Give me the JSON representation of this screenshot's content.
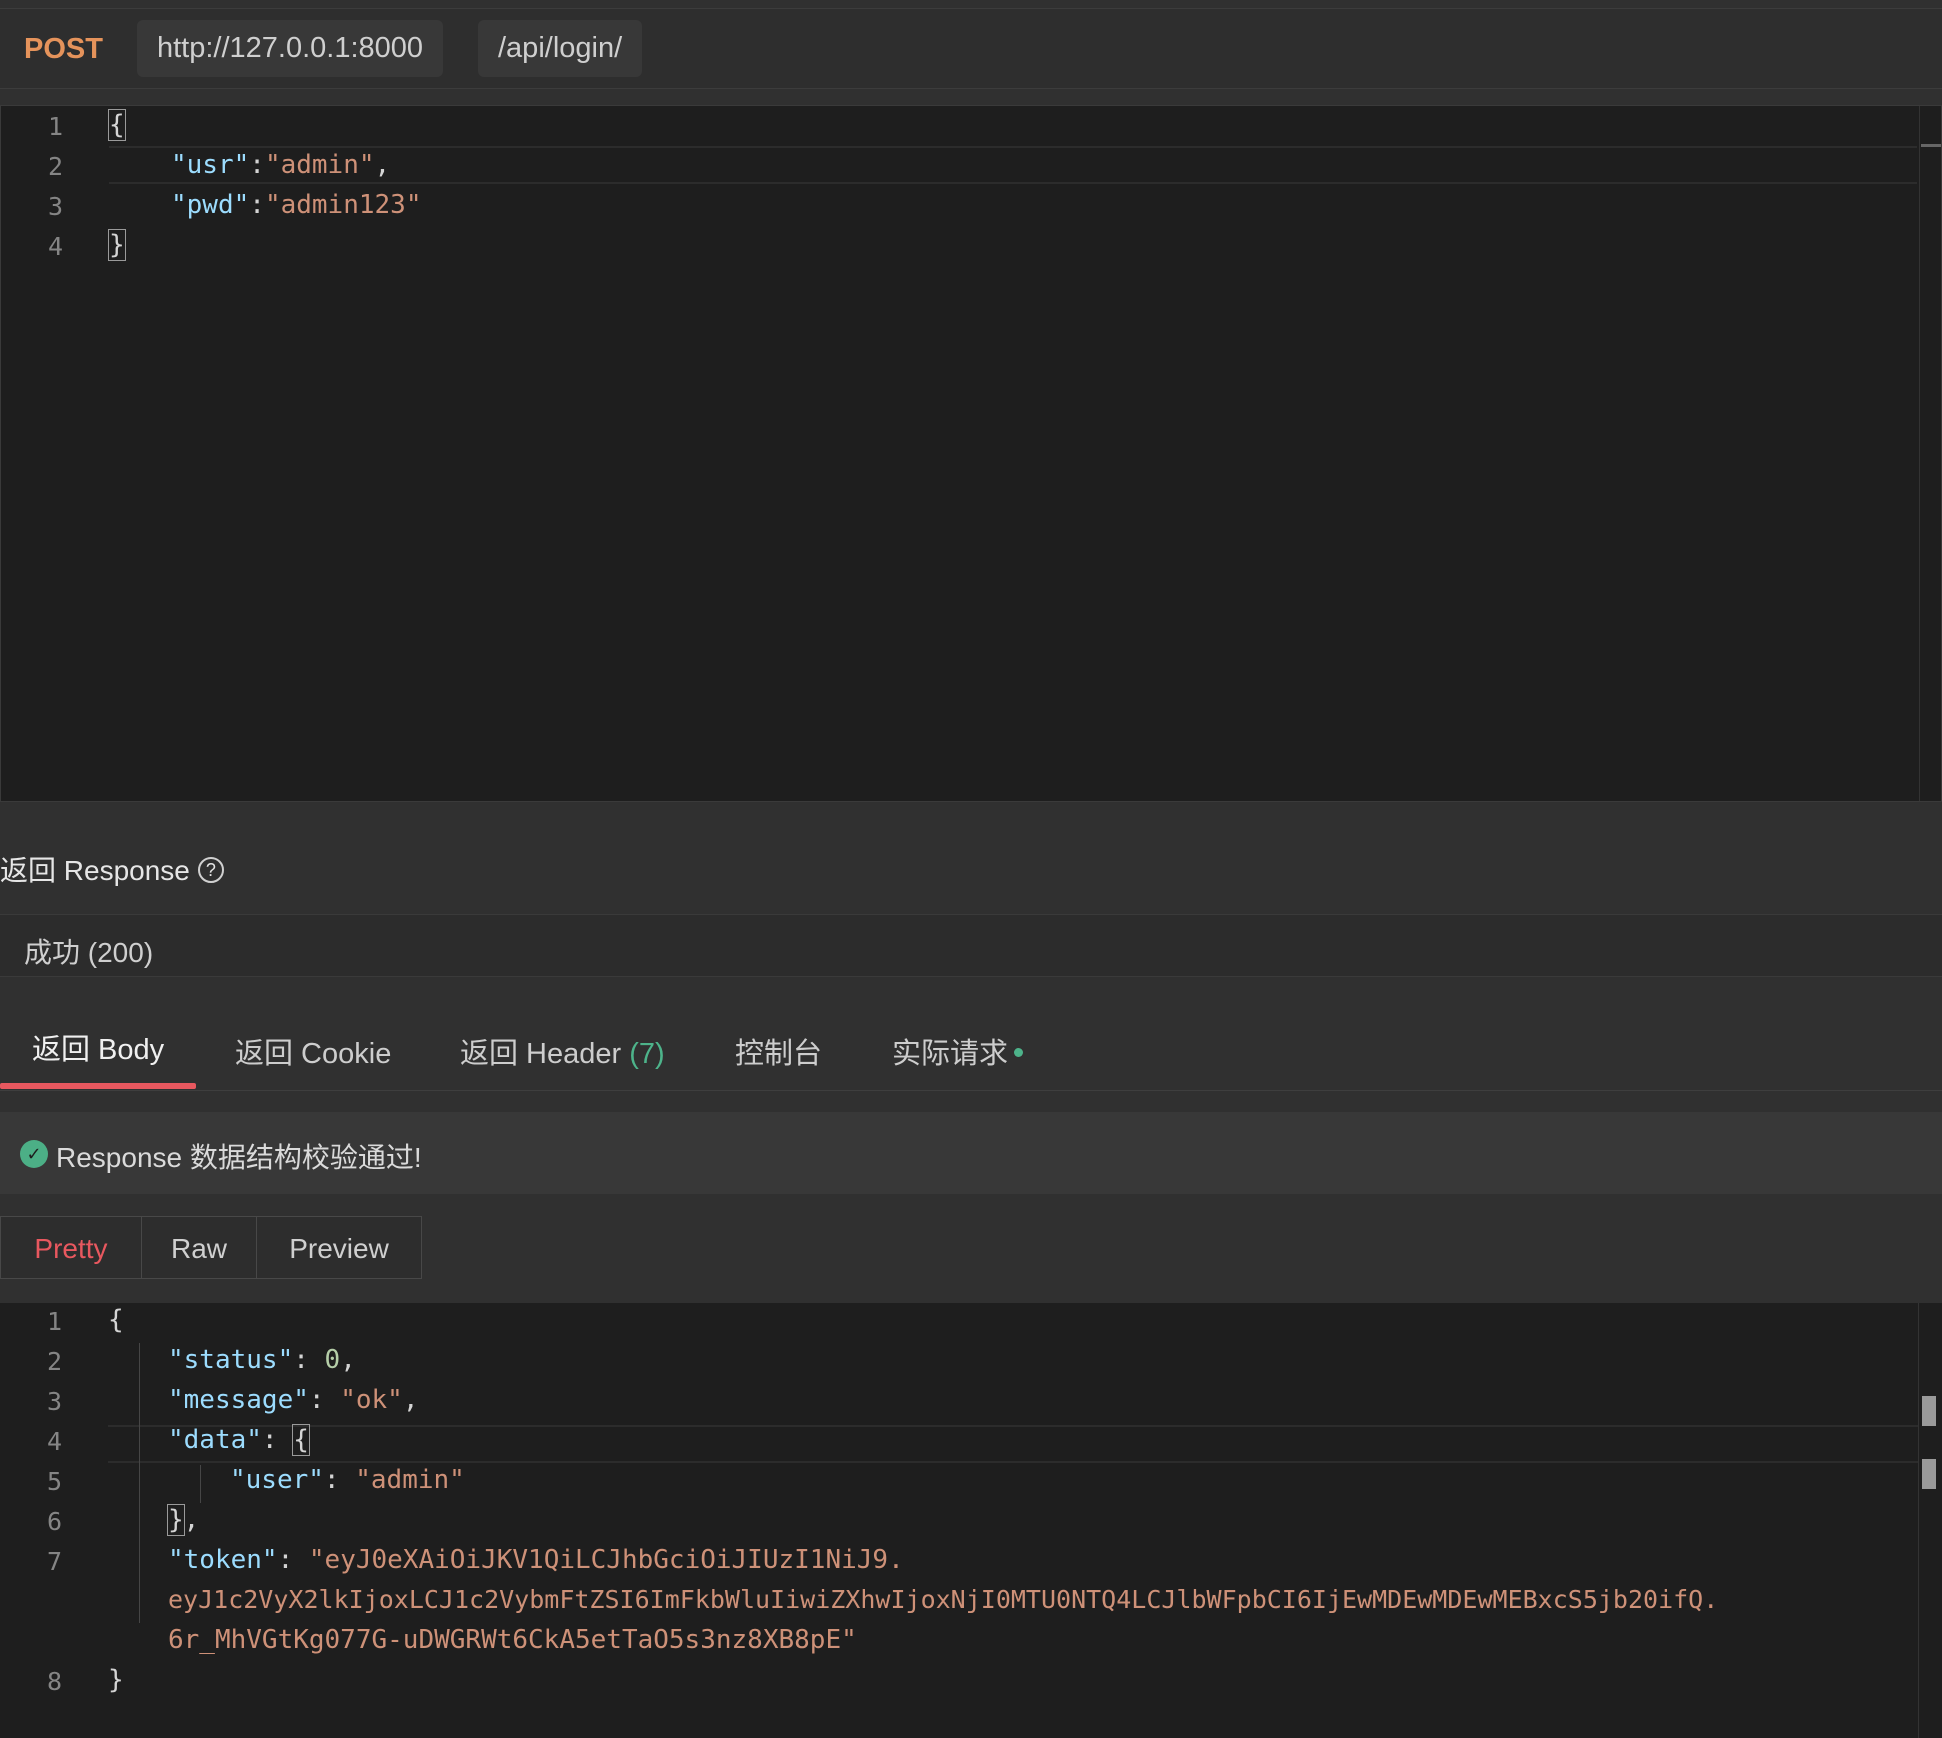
{
  "request": {
    "method": "POST",
    "host": "http://127.0.0.1:8000",
    "path": "/api/login/",
    "body_lines": [
      {
        "num": "1"
      },
      {
        "num": "2"
      },
      {
        "num": "3"
      },
      {
        "num": "4"
      }
    ],
    "body": {
      "open": "{",
      "close": "}",
      "usr_key": "\"usr\"",
      "usr_val": "\"admin\"",
      "pwd_key": "\"pwd\"",
      "pwd_val": "\"admin123\""
    }
  },
  "response": {
    "title": "返回 Response",
    "help_glyph": "?",
    "status": "成功 (200)",
    "tabs": {
      "body": "返回 Body",
      "cookie": "返回 Cookie",
      "header": "返回 Header",
      "header_count": "(7)",
      "console": "控制台",
      "actual": "实际请求"
    },
    "validation": {
      "icon": "✓",
      "text": "Response 数据结构校验通过!"
    },
    "view_modes": {
      "pretty": "Pretty",
      "raw": "Raw",
      "preview": "Preview"
    },
    "line_numbers": [
      "1",
      "2",
      "3",
      "4",
      "5",
      "6",
      "7",
      "8"
    ],
    "body": {
      "status_key": "\"status\"",
      "status_val": "0",
      "message_key": "\"message\"",
      "message_val": "\"ok\"",
      "data_key": "\"data\"",
      "user_key": "\"user\"",
      "user_val": "\"admin\"",
      "token_key": "\"token\"",
      "token_line1": "\"eyJ0eXAiOiJKV1QiLCJhbGciOiJIUzI1NiJ9.",
      "token_line2": "eyJ1c2VyX2lkIjoxLCJ1c2VybmFtZSI6ImFkbWluIiwiZXhwIjoxNjI0MTU0NTQ4LCJlbWFpbCI6IjEwMDEwMDEwMEBxcS5jb20ifQ.",
      "token_line3": "6r_MhVGtKg077G-uDWGRWt6CkA5etTaO5s3nz8XB8pE\""
    }
  }
}
